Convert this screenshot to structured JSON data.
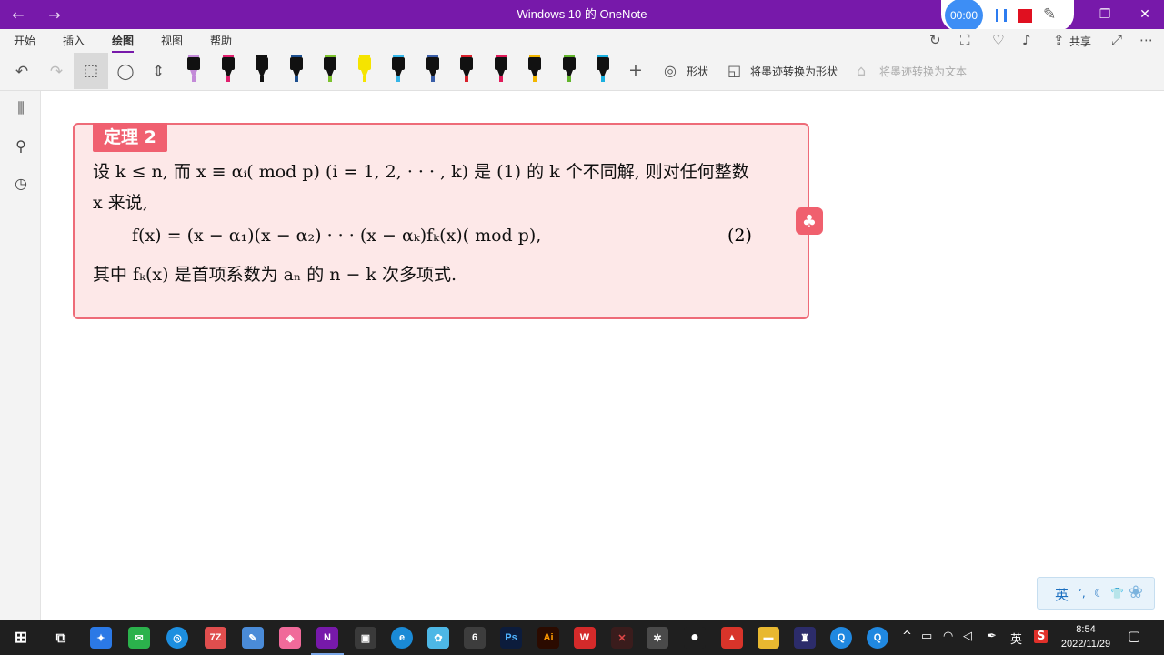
{
  "window": {
    "title": "Windows 10 的 OneNote",
    "back_icon": "arrow-left-icon",
    "forward_icon": "arrow-right-icon"
  },
  "recorder": {
    "timer": "00:00"
  },
  "ribbon": {
    "tabs": [
      {
        "label": "开始"
      },
      {
        "label": "插入"
      },
      {
        "label": "绘图"
      },
      {
        "label": "视图"
      },
      {
        "label": "帮助"
      }
    ],
    "active_tab": "绘图",
    "share_label": "共享"
  },
  "toolbar": {
    "shapes_label": "形状",
    "ink_to_shape_label": "将墨迹转换为形状",
    "ink_to_text_label": "将墨迹转换为文本",
    "pens": [
      {
        "color": "#c38ad8"
      },
      {
        "color": "#e0206e"
      },
      {
        "color": "#111111"
      },
      {
        "color": "#1d4f8f"
      },
      {
        "color": "#7cc22e"
      },
      {
        "color": "#f5e400"
      },
      {
        "color": "#35b5e8"
      },
      {
        "color": "#3a5ea8"
      },
      {
        "color": "#d8202a"
      },
      {
        "color": "#e01a5a"
      },
      {
        "color": "#f2b600"
      },
      {
        "color": "#62b52c"
      },
      {
        "color": "#1ab0e0"
      }
    ]
  },
  "theorem": {
    "label": "定理 2",
    "line1": "设 k ≤ n, 而 x ≡ αᵢ(  mod p) (i = 1, 2, · · · , k) 是 (1) 的 k 个不同解, 则对任何整数",
    "line2": "x 来说,",
    "equation": "f(x) = (x − α₁)(x − α₂) · · · (x − αₖ)fₖ(x)(  mod p),",
    "equation_number": "(2)",
    "line4": "其中 fₖ(x) 是首项系数为 aₙ 的 n − k 次多项式."
  },
  "ime": {
    "lang": "英"
  },
  "taskbar": {
    "time": "8:54",
    "date": "2022/11/29",
    "lang": "英"
  }
}
